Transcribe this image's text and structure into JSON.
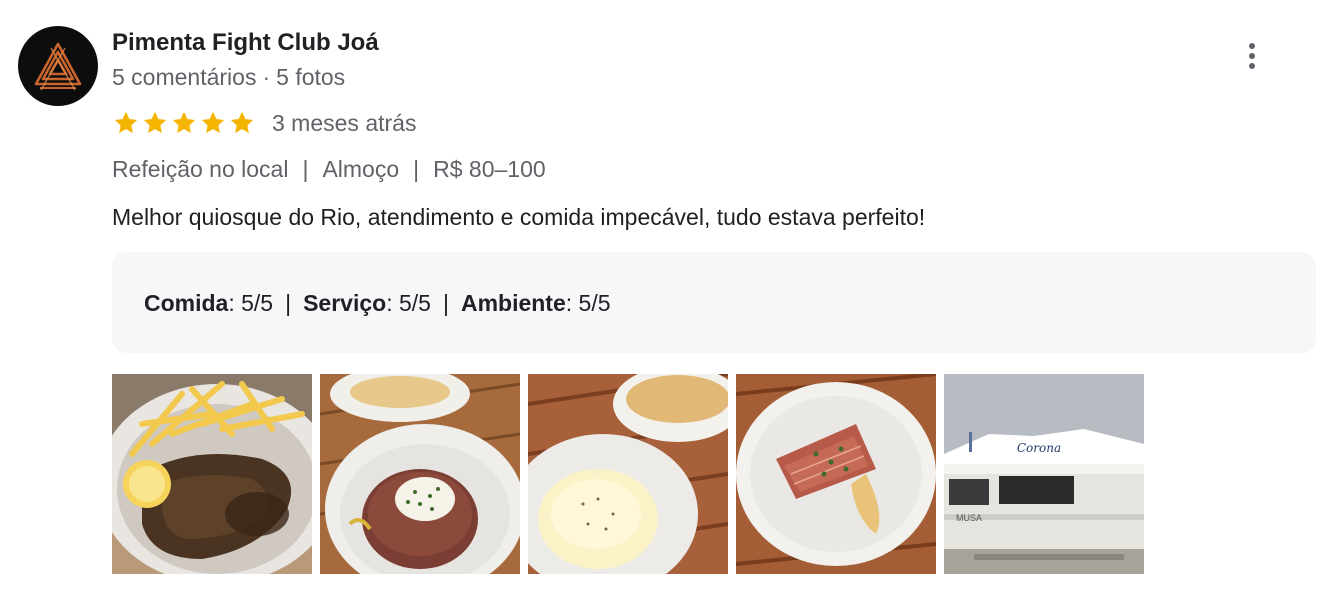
{
  "reviewer": {
    "name": "Pimenta Fight Club Joá",
    "comments": "5 comentários",
    "separator": "·",
    "photos_count": "5 fotos",
    "avatar_icon": "pimenta-triangle-logo-icon"
  },
  "rating": {
    "stars": 5,
    "max_stars": 5,
    "star_color": "#f4b400",
    "date": "3 meses atrás"
  },
  "attributes": {
    "service_type": "Refeição no local",
    "meal": "Almoço",
    "price": "R$ 80–100",
    "separator": "|"
  },
  "review_text": "Melhor quiosque do Rio, atendimento e comida impecável, tudo estava perfeito!",
  "subratings": {
    "food_label": "Comida",
    "food_value": ": 5/5",
    "service_label": "Serviço",
    "service_value": ": 5/5",
    "ambience_label": "Ambiente",
    "ambience_value": ": 5/5",
    "separator": "|"
  },
  "photos": [
    {
      "name": "steak-fries-photo"
    },
    {
      "name": "tartare-photo"
    },
    {
      "name": "cream-dish-photo"
    },
    {
      "name": "crudo-photo"
    },
    {
      "name": "kiosk-photo",
      "sign_text": "Corona",
      "side_text": "MUSA"
    }
  ],
  "menu": {
    "icon": "more-vertical-icon"
  },
  "colors": {
    "primary_text": "#202124",
    "secondary_text": "#5f6368",
    "subratings_bg": "#f6f7f9"
  }
}
